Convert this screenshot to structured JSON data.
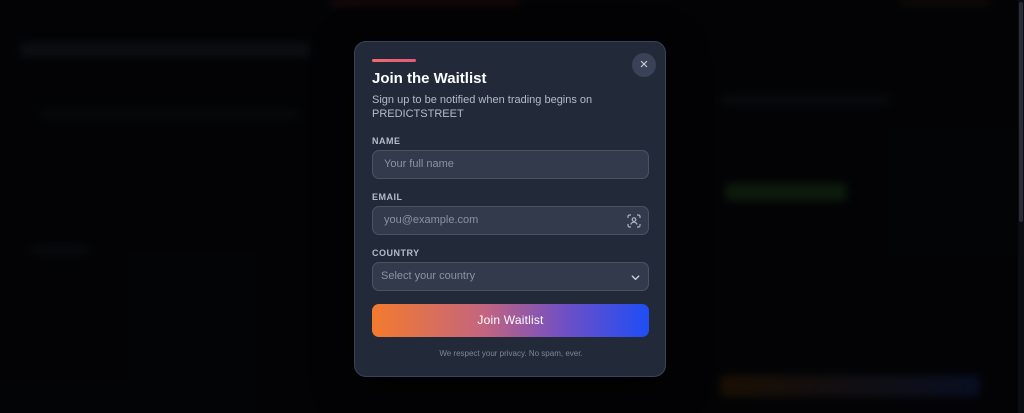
{
  "modal": {
    "title": "Join the Waitlist",
    "subtitle": "Sign up to be notified when trading begins on PREDICTSTREET",
    "close_symbol": "×",
    "name": {
      "label": "NAME",
      "placeholder": "Your full name"
    },
    "email": {
      "label": "EMAIL",
      "placeholder": "you@example.com",
      "icon": "contact-card-icon"
    },
    "country": {
      "label": "COUNTRY",
      "placeholder": "Select your country",
      "icon": "chevron-down-icon"
    },
    "submit_label": "Join Waitlist",
    "privacy_note": "We respect your privacy. No spam, ever."
  },
  "colors": {
    "modal_bg": "#222a3a",
    "accent": "#e8577d",
    "button_gradient_start": "#f37b2e",
    "button_gradient_end": "#1e4ef5"
  }
}
